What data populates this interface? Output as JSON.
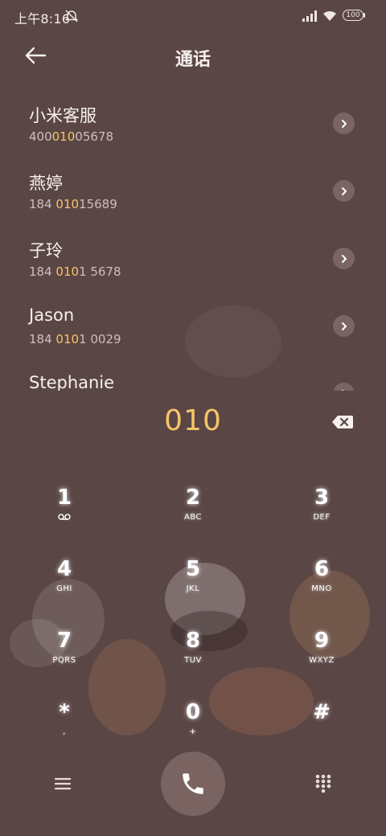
{
  "status_bar": {
    "time": "上午8:16",
    "battery": "100"
  },
  "header": {
    "title": "通话"
  },
  "contacts": [
    {
      "name": "小米客服",
      "number_pre": "400",
      "number_match": "010",
      "number_post": "05678"
    },
    {
      "name": "燕婷",
      "number_pre": "184 ",
      "number_match": "010",
      "number_post": "15689"
    },
    {
      "name": "子玲",
      "number_pre": "184 ",
      "number_match": "010",
      "number_post": "1 5678"
    },
    {
      "name": "Jason",
      "number_pre": "184 ",
      "number_match": "010",
      "number_post": "1 0029"
    },
    {
      "name": "Stephanie",
      "number_pre": "",
      "number_match": "",
      "number_post": ""
    }
  ],
  "dialer": {
    "entered_number": "010"
  },
  "keypad": [
    {
      "digit": "1",
      "letters": ""
    },
    {
      "digit": "2",
      "letters": "ABC"
    },
    {
      "digit": "3",
      "letters": "DEF"
    },
    {
      "digit": "4",
      "letters": "GHI"
    },
    {
      "digit": "5",
      "letters": "JKL"
    },
    {
      "digit": "6",
      "letters": "MNO"
    },
    {
      "digit": "7",
      "letters": "PQRS"
    },
    {
      "digit": "8",
      "letters": "TUV"
    },
    {
      "digit": "9",
      "letters": "WXYZ"
    },
    {
      "digit": "*",
      "letters": ","
    },
    {
      "digit": "0",
      "letters": "+"
    },
    {
      "digit": "#",
      "letters": ""
    }
  ],
  "colors": {
    "background": "#5a4644",
    "highlight": "#f7c46a",
    "call_button": "#7a6462"
  },
  "icons": {
    "back": "arrow-left-icon",
    "chevron": "chevron-right-icon",
    "backspace": "backspace-icon",
    "voicemail": "voicemail-icon",
    "menu": "menu-icon",
    "call": "phone-icon",
    "keypad": "dialpad-icon"
  }
}
